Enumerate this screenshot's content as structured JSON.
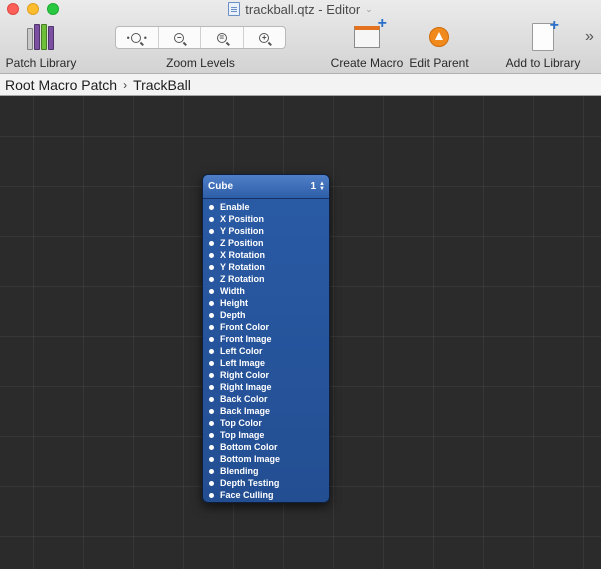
{
  "window": {
    "title": "trackball.qtz - Editor"
  },
  "toolbar": {
    "patch_library": "Patch Library",
    "zoom_levels": "Zoom Levels",
    "create_macro": "Create Macro",
    "edit_parent": "Edit Parent",
    "add_to_library": "Add to Library",
    "overflow": "»",
    "zoom_plus": "+"
  },
  "breadcrumb": {
    "root": "Root Macro Patch",
    "separator": "›",
    "current": "TrackBall"
  },
  "patch": {
    "name": "Cube",
    "index": "1",
    "stepper_up": "▲",
    "stepper_down": "▼",
    "ports": [
      "Enable",
      "X Position",
      "Y Position",
      "Z Position",
      "X Rotation",
      "Y Rotation",
      "Z Rotation",
      "Width",
      "Height",
      "Depth",
      "Front Color",
      "Front Image",
      "Left Color",
      "Left Image",
      "Right Color",
      "Right Image",
      "Back Color",
      "Back Image",
      "Top Color",
      "Top Image",
      "Bottom Color",
      "Bottom Image",
      "Blending",
      "Depth Testing",
      "Face Culling"
    ]
  },
  "colors": {
    "canvas": "#2b2b2b",
    "patch_body": "#2a5ba6",
    "patch_header": "#4f7fc7"
  }
}
